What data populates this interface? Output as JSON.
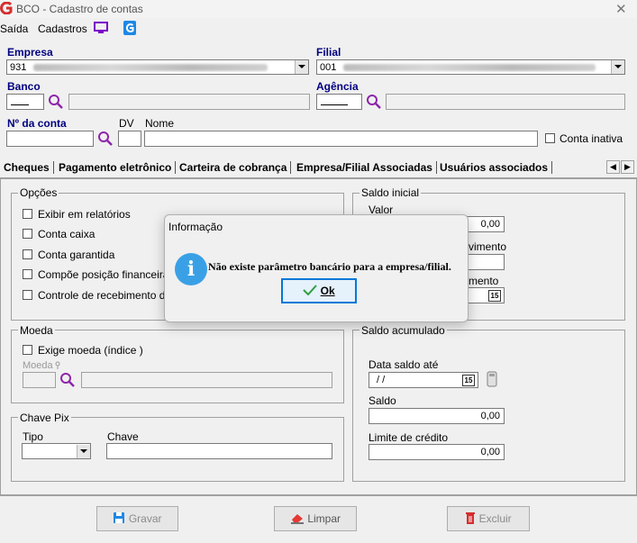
{
  "window": {
    "title": "BCO - Cadastro de contas"
  },
  "menu": {
    "items": [
      "Saída",
      "Cadastros"
    ]
  },
  "colors": {
    "label_blue": "#000080",
    "accent": "#0078d7",
    "info_icon": "#3aa0e6",
    "menu_monitor_icon": "#7a00c8",
    "app_icon": "#d32f2f"
  },
  "form": {
    "empresa": {
      "label": "Empresa",
      "value": "931"
    },
    "filial": {
      "label": "Filial",
      "value": "001"
    },
    "banco": {
      "label": "Banco",
      "value": ""
    },
    "agencia": {
      "label": "Agência",
      "value": ""
    },
    "conta": {
      "label": "Nº da conta",
      "value": ""
    },
    "dv": {
      "label": "DV",
      "value": ""
    },
    "nome": {
      "label": "Nome",
      "value": ""
    },
    "conta_inativa": {
      "label": "Conta inativa",
      "checked": false
    }
  },
  "tabs": [
    "Cheques",
    "Pagamento eletrônico",
    "Carteira de cobrança",
    "Empresa/Filial Associadas",
    "Usuários associados"
  ],
  "opcoes": {
    "title": "Opções",
    "items": [
      "Exibir em relatórios",
      "Conta caixa",
      "Conta garantida",
      "Compõe posição financeira",
      "Controle de recebimento de ch"
    ]
  },
  "saldo_inicial": {
    "title": "Saldo inicial",
    "valor_label": "Valor",
    "valor": "0,00",
    "vimento_label": "vimento",
    "mento_label": "mento",
    "cal_icon": "15"
  },
  "moeda": {
    "title": "Moeda",
    "exige_label": "Exige moeda (índice )",
    "moeda_label": "Moeda",
    "moeda_value": ""
  },
  "chave_pix": {
    "title": "Chave Pix",
    "tipo_label": "Tipo",
    "chave_label": "Chave",
    "tipo_value": "",
    "chave_value": ""
  },
  "saldo_acumulado": {
    "title": "Saldo acumulado",
    "data_label": "Data saldo até",
    "data_value": "/ /",
    "cal_icon": "15",
    "saldo_label": "Saldo",
    "saldo_value": "0,00",
    "limite_label": "Limite de crédito",
    "limite_value": "0,00"
  },
  "buttons": {
    "gravar": "Gravar",
    "limpar": "Limpar",
    "excluir": "Excluir"
  },
  "dialog": {
    "title": "Informação",
    "message": "Não existe parâmetro bancário para a empresa/filial.",
    "ok": "Ok",
    "icon": "i"
  }
}
